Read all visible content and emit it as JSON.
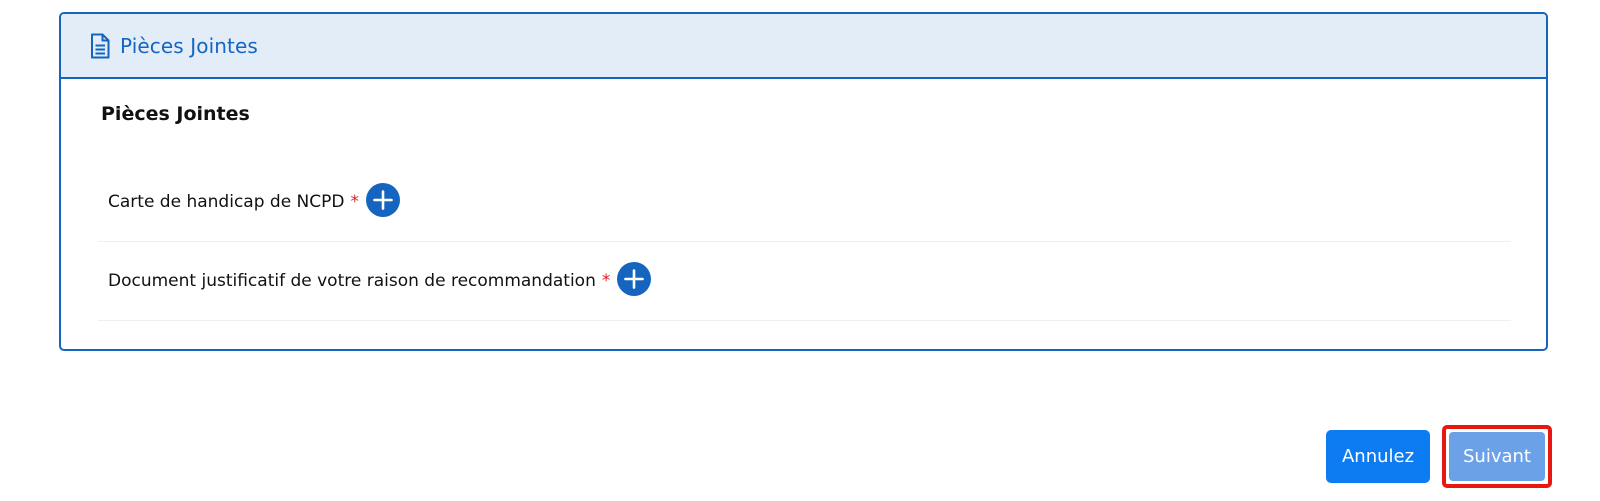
{
  "panel": {
    "header_title": "Pièces Jointes",
    "header_icon": "document-icon",
    "section_title": "Pièces Jointes",
    "attachments": [
      {
        "label": "Carte de handicap de NCPD",
        "required_marker": "*",
        "add_icon": "plus-icon"
      },
      {
        "label": "Document justificatif de votre raison de recommandation",
        "required_marker": "*",
        "add_icon": "plus-icon"
      }
    ]
  },
  "footer": {
    "cancel_label": "Annulez",
    "next_label": "Suivant"
  },
  "colors": {
    "accent": "#1565c0",
    "header_bg": "#e3edf8",
    "required": "#e0202f",
    "cancel_bg": "#0d7cf2",
    "next_bg": "#6ba1e6",
    "highlight_border": "#e8170f"
  }
}
